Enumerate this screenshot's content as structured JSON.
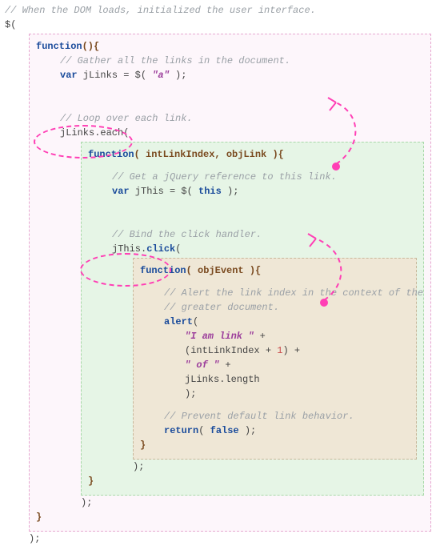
{
  "c_top": "// When the DOM loads, initialized the user interface.",
  "dollar_open": "$(",
  "fn_kw": "function",
  "fn_sig_outer": "(){",
  "c_gather": "// Gather all the links in the document.",
  "var_kw": "var",
  "jlinks_decl_pre": " jLinks = $( ",
  "str_a": "\"a\"",
  "jlinks_decl_post": " );",
  "c_loop": "// Loop over each link.",
  "each_call": "jLinks.each(",
  "fn_sig_each": "( intLinkIndex, objLink ){",
  "c_getref": "// Get a jQuery reference to this link.",
  "jthis_pre": " jThis = $( ",
  "this_kw": "this",
  "jthis_post": " );",
  "c_bind": "// Bind the click handler.",
  "click_call": "jThis.click(",
  "fn_sig_click": "( objEvent ){",
  "c_alert1": "// Alert the link index in the context of the",
  "c_alert2": "// greater document.",
  "alert_kw": "alert",
  "alert_open": "(",
  "str_iam": "\"I am link \"",
  "plus": " +",
  "paren_open": "(",
  "intlink": "intLinkIndex + ",
  "num_one": "1",
  "paren_close_plus": ") +",
  "str_of": "\" of \"",
  "jlinks_len": "jLinks.length",
  "close_paren_semi": ");",
  "c_prevent": "// Prevent default link behavior.",
  "return_kw": "return",
  "return_body": "( ",
  "false_kw": "false",
  "return_end": " );",
  "brace_close": "}",
  "close_invoke": ");"
}
